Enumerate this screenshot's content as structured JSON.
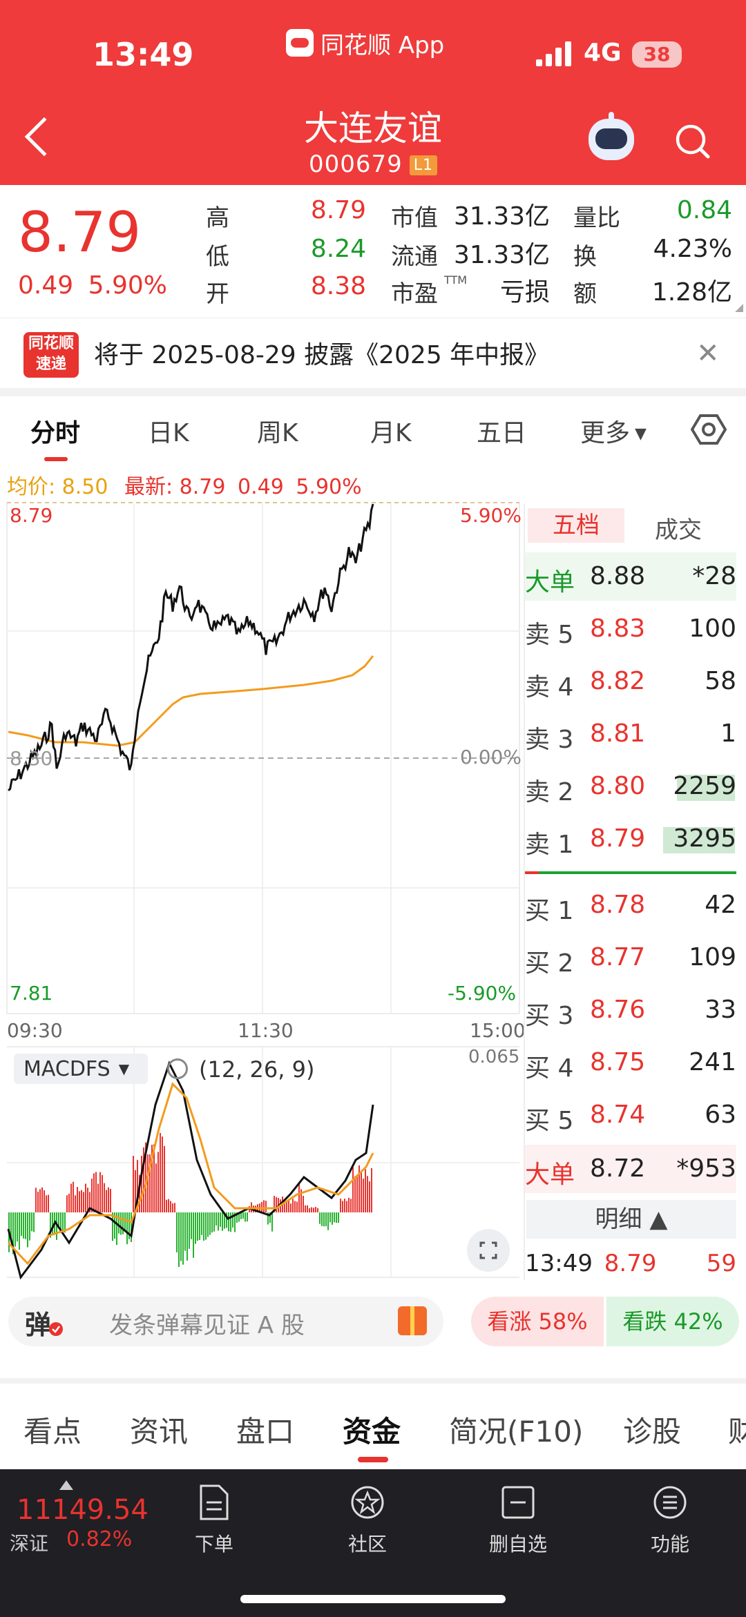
{
  "status_bar": {
    "time": "13:49",
    "app_name": "同花顺 App",
    "network": "4G",
    "battery": "38"
  },
  "header": {
    "title": "大连友谊",
    "code": "000679",
    "level_badge": "L1"
  },
  "quote": {
    "price": "8.79",
    "change": "0.49",
    "change_pct": "5.90%",
    "cells": [
      {
        "label": "高",
        "value": "8.79",
        "color": "#e8332e"
      },
      {
        "label": "低",
        "value": "8.24",
        "color": "#1a9a2a"
      },
      {
        "label": "开",
        "value": "8.38",
        "color": "#e8332e"
      },
      {
        "label": "市值",
        "value": "31.33亿",
        "color": "#222222"
      },
      {
        "label": "流通",
        "value": "31.33亿",
        "color": "#222222"
      },
      {
        "label": "市盈",
        "value": "亏损",
        "color": "#222222"
      },
      {
        "label": "量比",
        "value": "0.84",
        "color": "#1a9a2a"
      },
      {
        "label": "换",
        "value": "4.23%",
        "color": "#222222"
      },
      {
        "label": "额",
        "value": "1.28亿",
        "color": "#222222"
      }
    ],
    "ttm_tag": "TTM"
  },
  "notice": {
    "logo_line1": "同花顺",
    "logo_line2": "速递",
    "text": "将于 2025-08-29 披露《2025 年中报》"
  },
  "period_tabs": [
    "分时",
    "日K",
    "周K",
    "月K",
    "五日",
    "更多"
  ],
  "intraday": {
    "avg_label": "均价: 8.50",
    "latest_label": "最新: 8.79",
    "latest_change": "0.49",
    "latest_pct": "5.90%",
    "top_price": "8.79",
    "bottom_price": "7.81",
    "top_pct": "5.90%",
    "bottom_pct": "-5.90%",
    "mid_pct": "0.00%",
    "mid_price": "8.30",
    "time_labels": [
      "09:30",
      "11:30",
      "15:00"
    ]
  },
  "macd": {
    "indicator": "MACDFS",
    "params": "(12, 26, 9)",
    "top_value": "0.065"
  },
  "level_tabs": {
    "five": "五档",
    "deals": "成交"
  },
  "order_book": [
    {
      "label": "大单",
      "price": "8.88",
      "vol": "*28",
      "label_color": "#1a9a2a",
      "price_color": "#222222"
    },
    {
      "label": "卖 5",
      "price": "8.83",
      "vol": "100",
      "label_color": "#444444",
      "price_color": "#e8332e"
    },
    {
      "label": "卖 4",
      "price": "8.82",
      "vol": "58",
      "label_color": "#444444",
      "price_color": "#e8332e"
    },
    {
      "label": "卖 3",
      "price": "8.81",
      "vol": "1",
      "label_color": "#444444",
      "price_color": "#e8332e"
    },
    {
      "label": "卖 2",
      "price": "8.80",
      "vol": "2259",
      "label_color": "#444444",
      "price_color": "#e8332e"
    },
    {
      "label": "卖 1",
      "price": "8.79",
      "vol": "3295",
      "label_color": "#444444",
      "price_color": "#e8332e"
    },
    {
      "label": "买 1",
      "price": "8.78",
      "vol": "42",
      "label_color": "#444444",
      "price_color": "#e8332e"
    },
    {
      "label": "买 2",
      "price": "8.77",
      "vol": "109",
      "label_color": "#444444",
      "price_color": "#e8332e"
    },
    {
      "label": "买 3",
      "price": "8.76",
      "vol": "33",
      "label_color": "#444444",
      "price_color": "#e8332e"
    },
    {
      "label": "买 4",
      "price": "8.75",
      "vol": "241",
      "label_color": "#444444",
      "price_color": "#e8332e"
    },
    {
      "label": "买 5",
      "price": "8.74",
      "vol": "63",
      "label_color": "#444444",
      "price_color": "#e8332e"
    },
    {
      "label": "大单",
      "price": "8.72",
      "vol": "*953",
      "label_color": "#e8332e",
      "price_color": "#222222"
    }
  ],
  "detail": {
    "header": "明细 ▲",
    "time": "13:49",
    "price": "8.79",
    "vol": "59"
  },
  "barrage": {
    "icon": "弹",
    "placeholder": "发条弹幕见证 A 股",
    "bull": "看涨 58%",
    "bear": "看跌 42%"
  },
  "bottom_tabs": [
    "看点",
    "资讯",
    "盘口",
    "资金",
    "简况(F10)",
    "诊股",
    "财"
  ],
  "bottom_nav": {
    "index_value": "11149.54",
    "index_name": "深证",
    "index_pct": "0.82%",
    "items": [
      {
        "label": "下单",
        "icon": "order-icon"
      },
      {
        "label": "社区",
        "icon": "community-icon"
      },
      {
        "label": "删自选",
        "icon": "remove-watchlist-icon"
      },
      {
        "label": "功能",
        "icon": "menu-icon"
      }
    ]
  },
  "colors": {
    "brand_red": "#ef3b3b",
    "up": "#e8332e",
    "down": "#1a9a2a",
    "avg_line": "#f39b1c"
  }
}
